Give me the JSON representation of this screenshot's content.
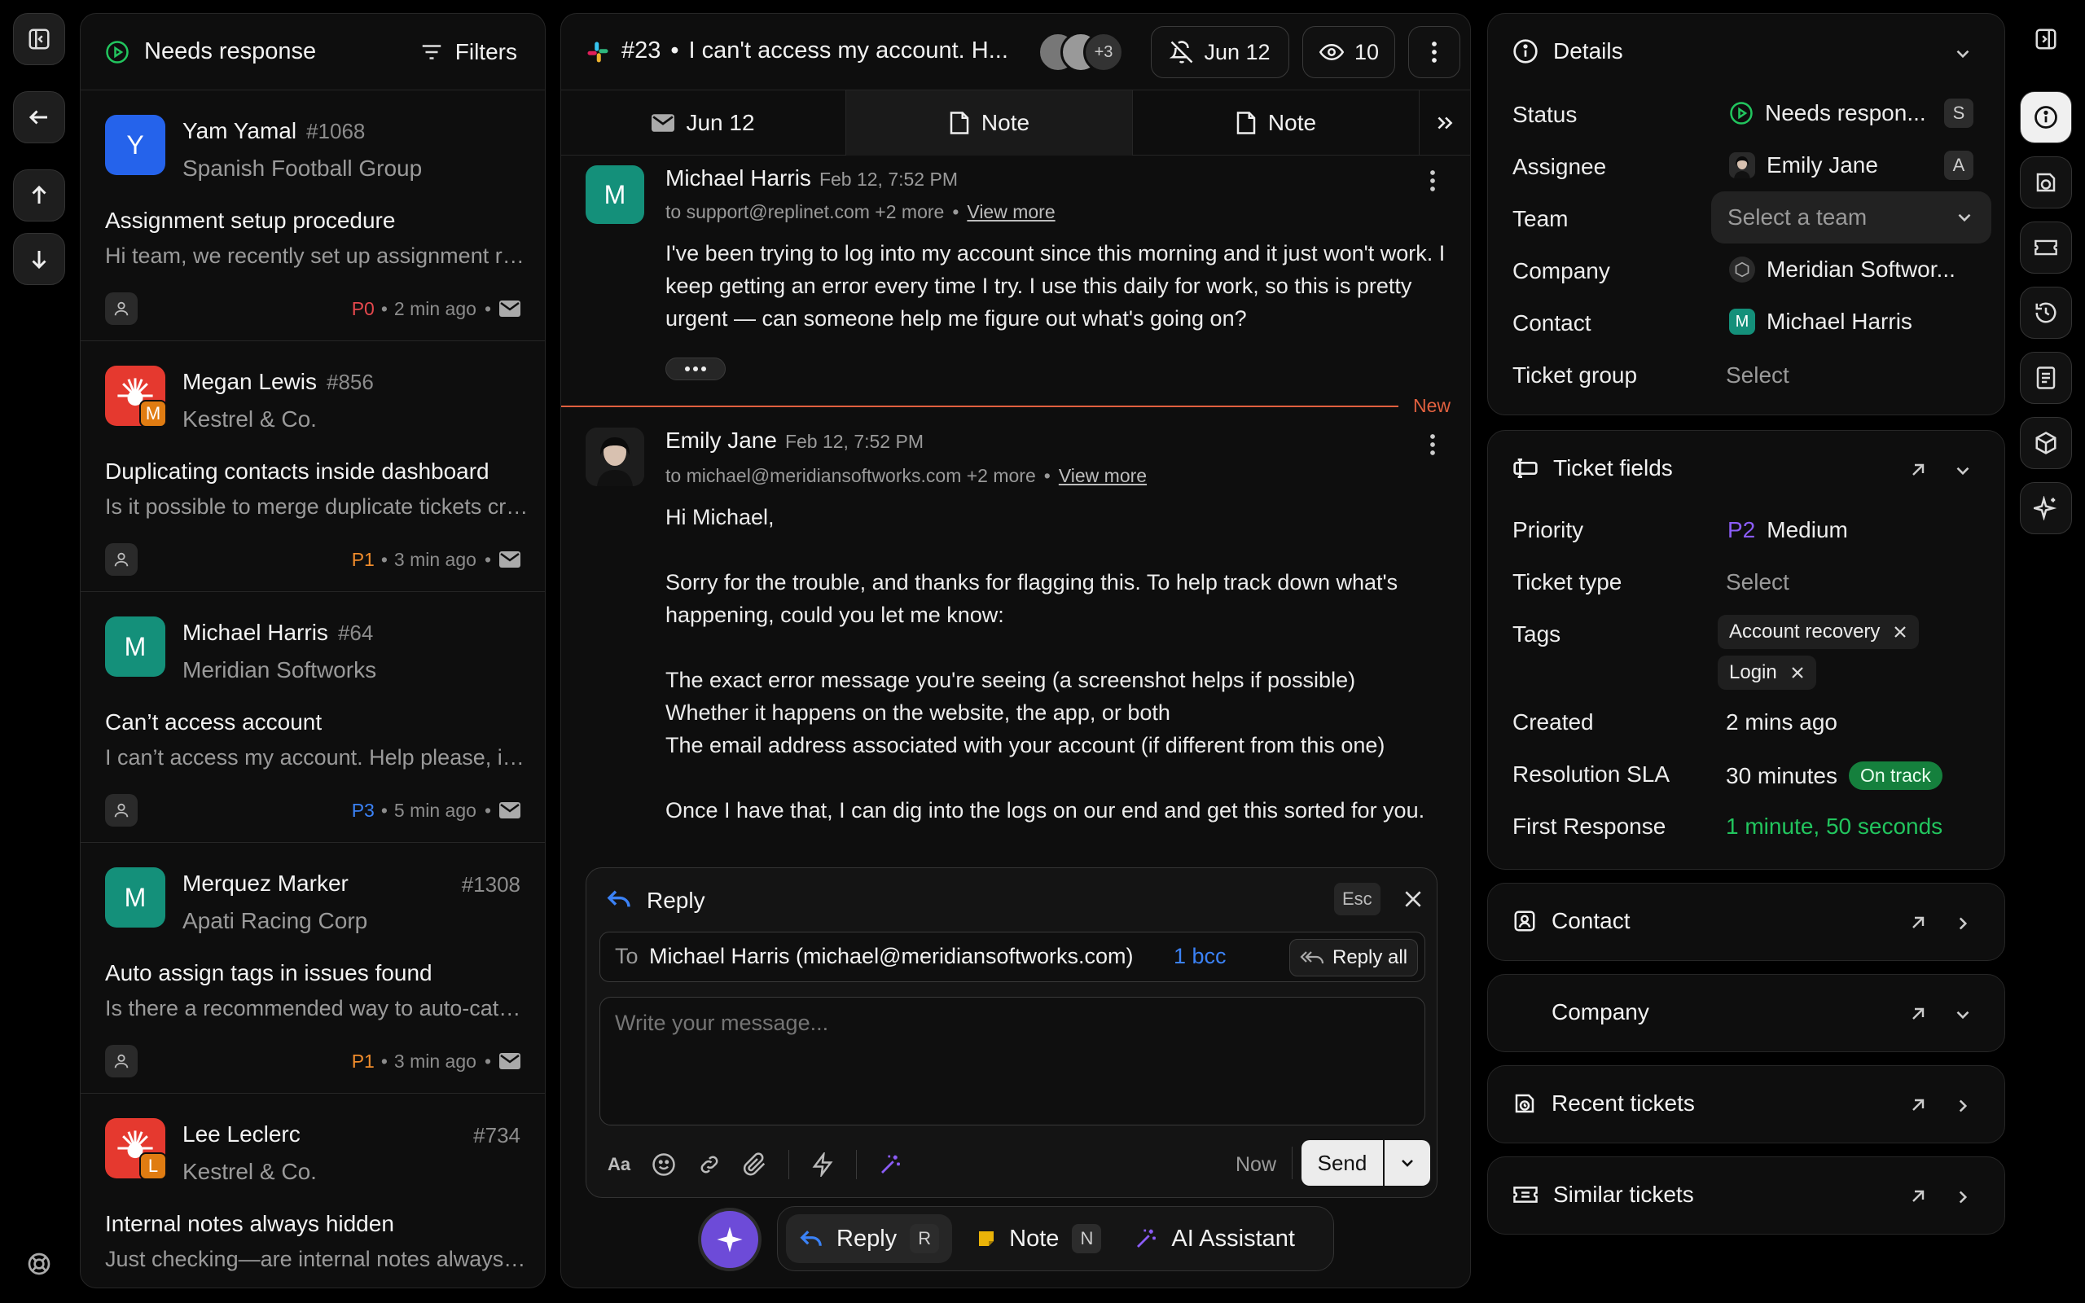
{
  "inbox": {
    "title": "Needs response",
    "filters_label": "Filters",
    "tickets": [
      {
        "name": "Yam Yamal",
        "number": "#1068",
        "company": "Spanish Football Group",
        "subject": "Assignment setup procedure",
        "preview": "Hi team, we recently set up assignment rules and want to confirm",
        "priority": "P0",
        "priority_color": "#e5484d",
        "time": "2 min ago",
        "avatar_letter": "Y",
        "avatar_color": "#2563eb"
      },
      {
        "name": "Megan Lewis",
        "number": "#856",
        "company": "Kestrel & Co.",
        "subject": "Duplicating contacts inside dashboard",
        "preview": "Is it possible to merge duplicate tickets created by contacts",
        "priority": "P1",
        "priority_color": "#f08c2c",
        "time": "3 min ago",
        "avatar_badge": "M"
      },
      {
        "name": "Michael Harris",
        "number": "#64",
        "company": "Meridian Softworks",
        "subject": "Can’t access account",
        "preview": "I can’t access my account. Help please, it keeps failing",
        "priority": "P3",
        "priority_color": "#3b82f6",
        "time": "5 min ago",
        "avatar_letter": "M",
        "avatar_color": "#14907a"
      },
      {
        "name": "Merquez Marker",
        "number": "#1308",
        "company": "Apati Racing Corp",
        "subject": "Auto assign tags in issues found",
        "preview": "Is there a recommended way to auto-categorize incoming issues",
        "priority": "P1",
        "priority_color": "#f08c2c",
        "time": "3 min ago",
        "avatar_letter": "M",
        "avatar_color": "#14907a"
      },
      {
        "name": "Lee Leclerc",
        "number": "#734",
        "company": "Kestrel & Co.",
        "subject": "Internal notes always hidden",
        "preview": "Just checking—are internal notes always hidden from customers",
        "avatar_badge": "L"
      }
    ]
  },
  "ticket": {
    "number": "#23",
    "title": "I can't access my account. H...",
    "participants_extra": "+3",
    "snooze_date": "Jun 12",
    "watchers": "10",
    "tabs": [
      "Jun 12",
      "Note",
      "Note"
    ]
  },
  "messages": [
    {
      "name": "Michael Harris",
      "time": "Feb 12, 7:52 PM",
      "to": "to support@replinet.com +2 more",
      "view_more": "View more",
      "body": "I've been trying to log into my account since this morning and it just won't work. I keep getting an error every time I try. I use this daily for work, so this is pretty urgent — can someone help me figure out what's going on?"
    },
    {
      "name": "Emily Jane",
      "time": "Feb 12, 7:52 PM",
      "to": "to michael@meridiansoftworks.com +2 more",
      "view_more": "View more",
      "new_label": "New",
      "lines": [
        "Hi Michael,",
        "Sorry for the trouble, and thanks for flagging this. To help track down what's happening, could you let me know:",
        "The exact error message you're seeing (a screenshot helps if possible)",
        "Whether it happens on the website, the app, or both",
        "The email address associated with your account (if different from this one)",
        "Once I have that, I can dig into the logs on our end and get this sorted for you."
      ]
    }
  ],
  "composer": {
    "mode": "Reply",
    "esc": "Esc",
    "to_label": "To",
    "to_value": "Michael Harris (michael@meridiansoftworks.com)",
    "bcc": "1 bcc",
    "reply_all": "Reply all",
    "placeholder": "Write your message...",
    "schedule": "Now",
    "send": "Send"
  },
  "bottom_bar": {
    "reply": "Reply",
    "reply_key": "R",
    "note": "Note",
    "note_key": "N",
    "ai": "AI Assistant"
  },
  "details": {
    "title": "Details",
    "rows": {
      "status_label": "Status",
      "status_value": "Needs respon...",
      "status_key": "S",
      "assignee_label": "Assignee",
      "assignee_value": "Emily Jane",
      "assignee_key": "A",
      "team_label": "Team",
      "team_placeholder": "Select a team",
      "company_label": "Company",
      "company_value": "Meridian Softwor...",
      "contact_label": "Contact",
      "contact_value": "Michael Harris",
      "contact_initial": "M",
      "group_label": "Ticket group",
      "group_value": "Select"
    }
  },
  "ticket_fields": {
    "title": "Ticket fields",
    "priority_label": "Priority",
    "priority_code": "P2",
    "priority_value": "Medium",
    "type_label": "Ticket type",
    "type_value": "Select",
    "tags_label": "Tags",
    "tags": [
      "Account recovery",
      "Login"
    ],
    "created_label": "Created",
    "created_value": "2 mins ago",
    "sla_label": "Resolution SLA",
    "sla_value": "30 minutes",
    "sla_status": "On track",
    "first_response_label": "First Response",
    "first_response_value": "1 minute, 50 seconds"
  },
  "sections": [
    "Contact",
    "Company",
    "Recent tickets",
    "Similar tickets"
  ],
  "colors": {
    "accent_purple": "#8b5cf6",
    "success": "#22c55e",
    "link_blue": "#3b82f6",
    "new_line": "#e0603f"
  }
}
